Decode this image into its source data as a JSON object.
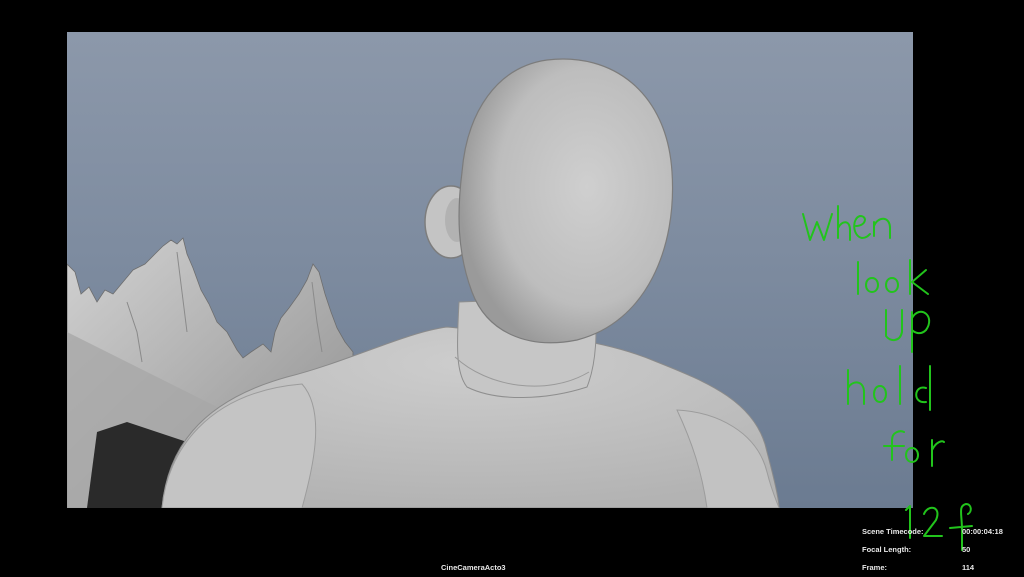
{
  "viewport": {
    "camera_name": "CineCameraActo3"
  },
  "hud": {
    "scene_timecode_label": "Scene Timecode:",
    "scene_timecode_value": "00:00:04:18",
    "focal_length_label": "Focal Length:",
    "focal_length_value": "50",
    "frame_label": "Frame:",
    "frame_value": "114"
  },
  "annotation": {
    "color": "#22c41c",
    "note": "when look up hold for 12 f"
  },
  "colors": {
    "sky_top": "#8c98aa",
    "sky_bottom": "#6b7b91",
    "mannequin": "#c9c9c9",
    "background": "#000000"
  }
}
